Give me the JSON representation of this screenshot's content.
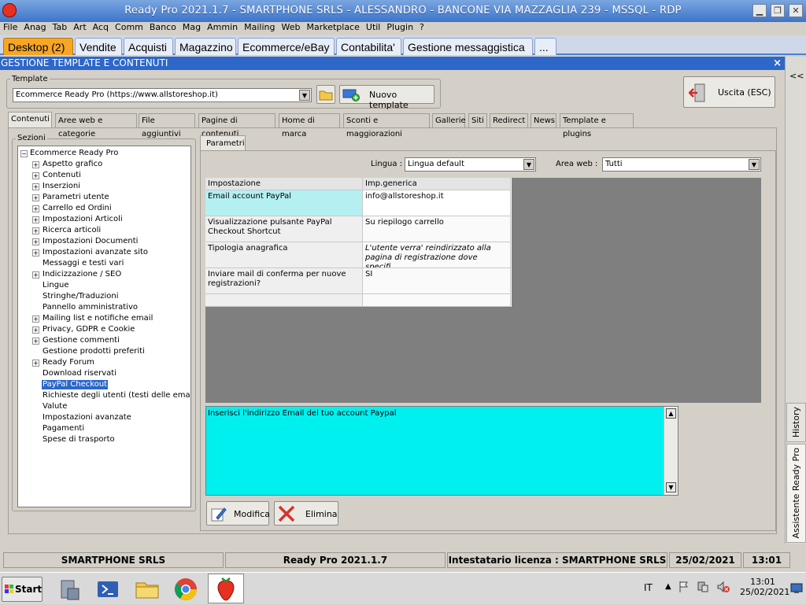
{
  "window": {
    "title": "Ready Pro 2021.1.7 - SMARTPHONE SRLS - ALESSANDRO - BANCONE VIA MAZZAGLIA 239 - MSSQL - RDP"
  },
  "menu": [
    "File",
    "Anag",
    "Tab",
    "Art",
    "Acq",
    "Comm",
    "Banco",
    "Mag",
    "Ammin",
    "Mailing",
    "Web",
    "Marketplace",
    "Util",
    "Plugin",
    "?"
  ],
  "top_tabs": [
    "Desktop (2)",
    "Vendite",
    "Acquisti",
    "Magazzino",
    "Ecommerce/eBay",
    "Contabilita'",
    "Gestione messaggistica",
    "..."
  ],
  "section": {
    "title": "GESTIONE TEMPLATE E CONTENUTI",
    "close": "×"
  },
  "template": {
    "label": "Template",
    "value": "Ecommerce Ready Pro (https://www.allstoreshop.it)",
    "new_button": "Nuovo template"
  },
  "exit_button": "Uscita (ESC)",
  "sub_tabs": [
    "Contenuti",
    "Aree web e categorie",
    "File aggiuntivi",
    "Pagine di contenuti",
    "Home di marca",
    "Sconti e maggiorazioni",
    "Gallerie",
    "Siti",
    "Redirect",
    "News",
    "Template e plugins"
  ],
  "sections": {
    "label": "Sezioni",
    "root": "Ecommerce Ready Pro",
    "items": [
      {
        "label": "Aspetto grafico",
        "expandable": true
      },
      {
        "label": "Contenuti",
        "expandable": true
      },
      {
        "label": "Inserzioni",
        "expandable": true
      },
      {
        "label": "Parametri utente",
        "expandable": true
      },
      {
        "label": "Carrello ed Ordini",
        "expandable": true
      },
      {
        "label": "Impostazioni Articoli",
        "expandable": true
      },
      {
        "label": "Ricerca articoli",
        "expandable": true
      },
      {
        "label": "Impostazioni Documenti",
        "expandable": true
      },
      {
        "label": "Impostazioni avanzate sito",
        "expandable": true
      },
      {
        "label": "Messaggi e testi vari",
        "expandable": false
      },
      {
        "label": "Indicizzazione / SEO",
        "expandable": true
      },
      {
        "label": "Lingue",
        "expandable": false
      },
      {
        "label": "Stringhe/Traduzioni",
        "expandable": false
      },
      {
        "label": "Pannello amministrativo",
        "expandable": false
      },
      {
        "label": "Mailing list e notifiche email",
        "expandable": true
      },
      {
        "label": "Privacy, GDPR e Cookie",
        "expandable": true
      },
      {
        "label": "Gestione commenti",
        "expandable": true
      },
      {
        "label": "Gestione prodotti preferiti",
        "expandable": false
      },
      {
        "label": "Ready Forum",
        "expandable": true
      },
      {
        "label": "Download riservati",
        "expandable": false
      },
      {
        "label": "PayPal Checkout",
        "expandable": false,
        "selected": true
      },
      {
        "label": "Richieste degli utenti (testi delle email)",
        "expandable": false
      },
      {
        "label": "Valute",
        "expandable": false
      },
      {
        "label": "Impostazioni avanzate",
        "expandable": false
      },
      {
        "label": "Pagamenti",
        "expandable": false
      },
      {
        "label": "Spese di trasporto",
        "expandable": false
      }
    ]
  },
  "params": {
    "tab": "Parametri",
    "lingua_label": "Lingua :",
    "lingua_value": "Lingua default",
    "area_label": "Area web :",
    "area_value": "Tutti",
    "headers": [
      "Impostazione",
      "Imp.generica"
    ],
    "rows": [
      {
        "setting": "Email account PayPal",
        "value": "info@allstoreshop.it"
      },
      {
        "setting": "Visualizzazione pulsante PayPal Checkout Shortcut",
        "value": "Su riepilogo carrello"
      },
      {
        "setting": "Tipologia anagrafica",
        "value": "L'utente verra' reindirizzato alla pagina di registrazione dove specifi..."
      },
      {
        "setting": "Inviare mail di conferma per nuove registrazioni?",
        "value": "SI"
      }
    ],
    "description": "Inserisci l'indirizzo Email del tuo account Paypal",
    "modify_button": "Modifica",
    "delete_button": "Elimina"
  },
  "side": {
    "history": "History",
    "assistant": "Assistente Ready Pro",
    "collapse": "<<"
  },
  "status": {
    "company": "SMARTPHONE SRLS",
    "version": "Ready Pro 2021.1.7",
    "license": "Intestatario licenza : SMARTPHONE SRLS",
    "date": "25/02/2021",
    "time": "13:01"
  },
  "taskbar": {
    "start": "Start",
    "lang": "IT",
    "clock_time": "13:01",
    "clock_date": "25/02/2021"
  }
}
